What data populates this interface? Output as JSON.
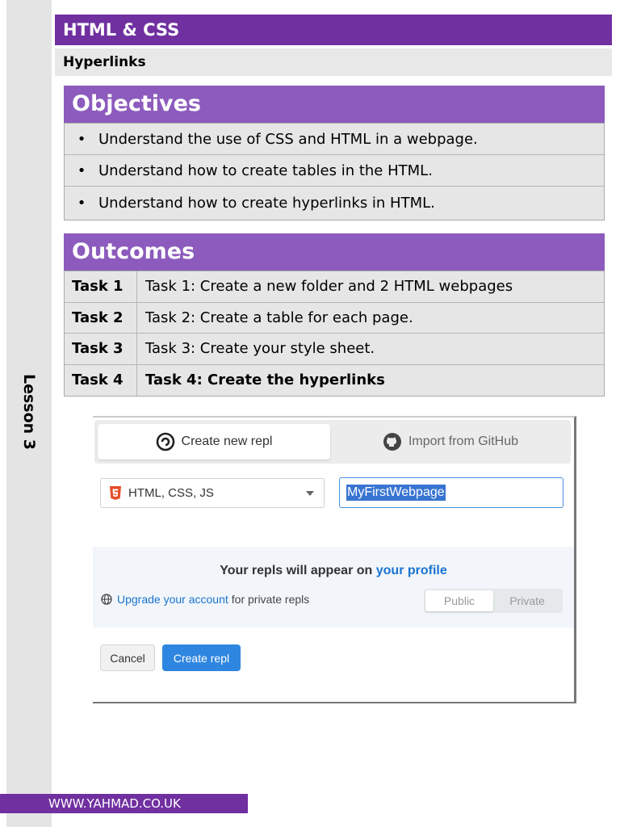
{
  "header": {
    "title": "HTML & CSS",
    "subtitle": "Hyperlinks"
  },
  "side": {
    "lesson_label": "Lesson 3"
  },
  "objectives": {
    "heading": "Objectives",
    "bullet": "•",
    "items": [
      "Understand the use of CSS and HTML in a webpage.",
      "Understand how to create tables in the HTML.",
      "Understand how to create hyperlinks in HTML."
    ]
  },
  "outcomes": {
    "heading": "Outcomes",
    "rows": [
      {
        "task": "Task 1",
        "description": "Task 1: Create a new folder and 2 HTML webpages"
      },
      {
        "task": "Task 2",
        "description": "Task 2: Create a table for each page."
      },
      {
        "task": "Task 3",
        "description": "Task 3: Create your style sheet."
      },
      {
        "task": "Task 4",
        "description": "Task 4: Create the hyperlinks"
      }
    ]
  },
  "repl_dialog": {
    "tab_create": "Create new repl",
    "tab_import": "Import from GitHub",
    "language_select": "HTML, CSS, JS",
    "name_value": "MyFirstWebpage",
    "info_prefix": "Your repls will appear on ",
    "info_link": "your profile",
    "upgrade_link": "Upgrade your account",
    "upgrade_suffix": "for private repls",
    "visibility_public": "Public",
    "visibility_private": "Private",
    "cancel_label": "Cancel",
    "create_label": "Create repl",
    "colors": {
      "accent_blue": "#2f86e0",
      "link_blue": "#1a73d1",
      "html5_orange": "#e44d26"
    }
  },
  "footer": {
    "url": "WWW.YAHMAD.CO.UK"
  },
  "colors": {
    "brand_purple": "#7030a0",
    "section_purple": "#8c5bbd"
  }
}
